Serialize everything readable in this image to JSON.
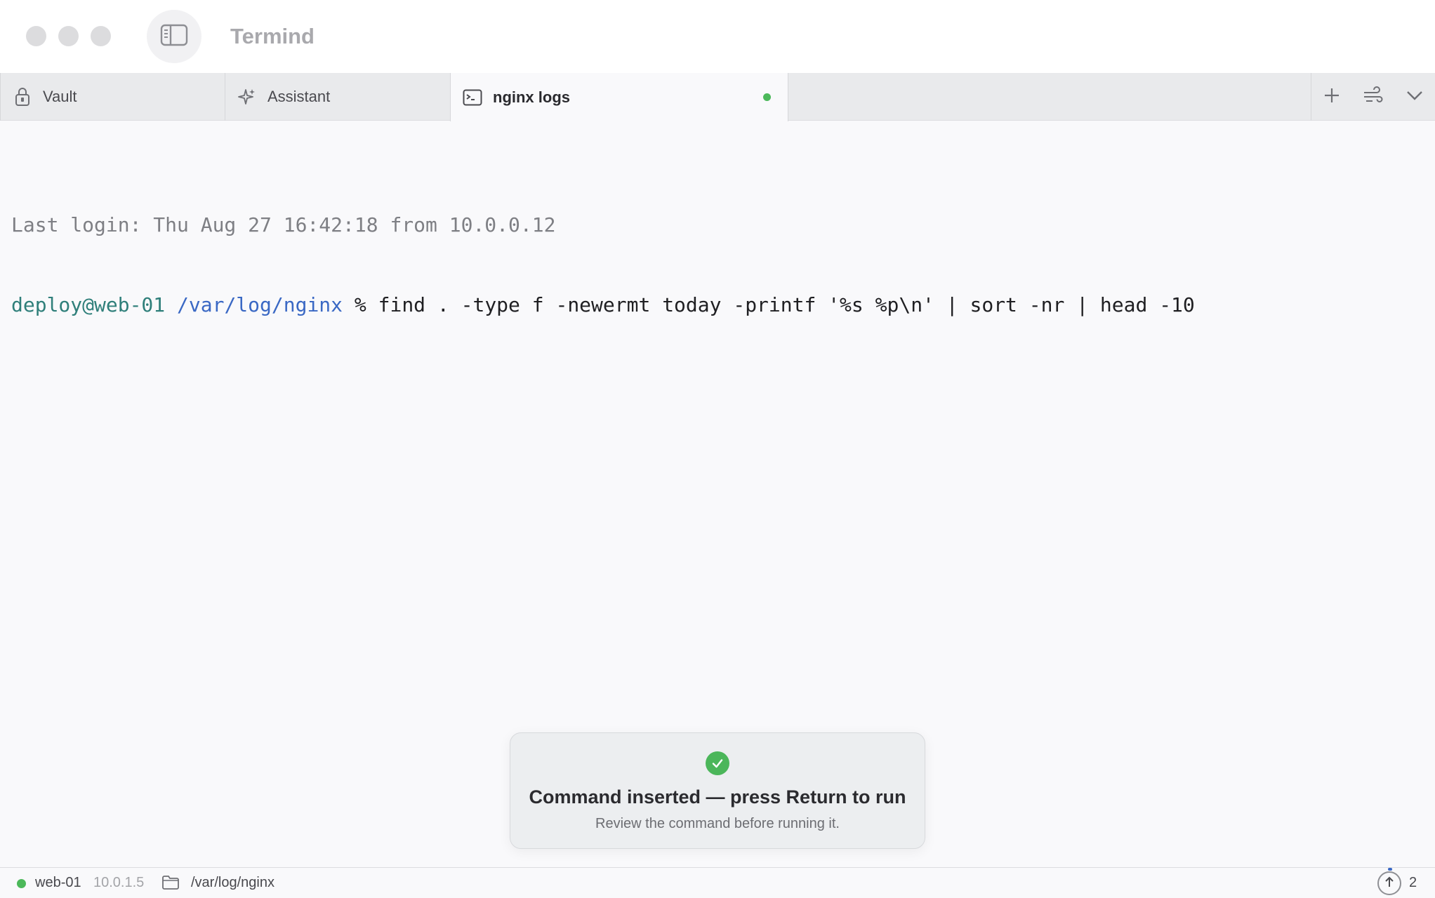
{
  "window": {
    "title": "Termind"
  },
  "tabs": [
    {
      "label": "Vault",
      "icon": "lock-icon",
      "active": false
    },
    {
      "label": "Assistant",
      "icon": "sparkle-icon",
      "active": false
    },
    {
      "label": "nginx logs",
      "icon": "terminal-icon",
      "active": true,
      "status_color": "#4cb85a"
    }
  ],
  "tab_actions": [
    "plus-icon",
    "wind-icon",
    "chevron-down-icon"
  ],
  "terminal": {
    "last_login": "Last login: Thu Aug 27 16:42:18 from 10.0.0.12",
    "prompt_user": "deploy@web-01",
    "prompt_path": "/var/log/nginx",
    "prompt_symbol": "%",
    "command": "find . -type f -newermt today -printf '%s %p\\n' | sort -nr | head -10"
  },
  "toast": {
    "title": "Command inserted — press Return to run",
    "subtitle": "Review the command before running it.",
    "icon": "check-circle-icon",
    "color": "#4bb65a"
  },
  "statusbar": {
    "host": "web-01",
    "ip": "10.0.1.5",
    "cwd": "/var/log/nginx",
    "upload_count": "2",
    "connection_color": "#4cb85a"
  }
}
